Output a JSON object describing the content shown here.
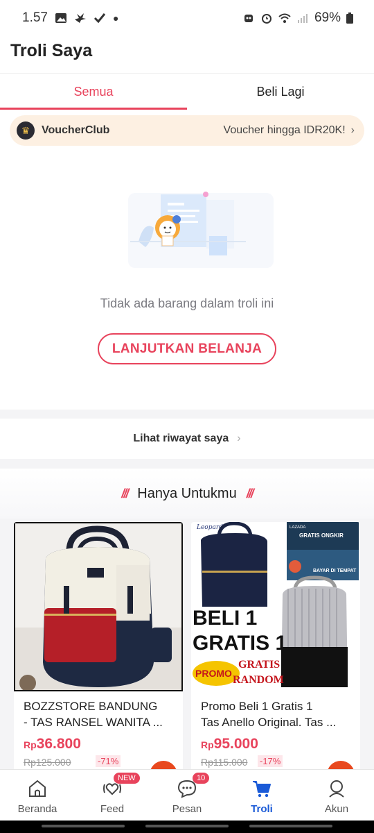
{
  "status_bar": {
    "time": "1.57",
    "battery": "69%"
  },
  "header": {
    "title": "Troli Saya"
  },
  "tabs": [
    {
      "label": "Semua",
      "active": true
    },
    {
      "label": "Beli Lagi",
      "active": false
    }
  ],
  "voucher": {
    "name": "VoucherClub",
    "promo": "Voucher hingga IDR20K!"
  },
  "empty_state": {
    "message": "Tidak ada barang dalam troli ini",
    "button_label": "LANJUTKAN BELANJA"
  },
  "history": {
    "label": "Lihat riwayat saya"
  },
  "for_you": {
    "title": "Hanya Untukmu"
  },
  "products": [
    {
      "name_line1": "BOZZSTORE BANDUNG",
      "name_line2": "- TAS RANSEL WANITA ...",
      "currency": "Rp",
      "price": "36.800",
      "original_price": "Rp125.000",
      "discount": "-71%"
    },
    {
      "name_line1": "Promo Beli 1 Gratis 1",
      "name_line2": "Tas Anello Original. Tas ...",
      "currency": "Rp",
      "price": "95.000",
      "original_price": "Rp115.000",
      "discount": "-17%",
      "image_text": {
        "brand": "Leopard",
        "lazada": "LAZADA",
        "gratis_ongkir": "GRATIS ONGKIR",
        "bayar": "BAYAR DI TEMPAT",
        "headline1": "BELI 1",
        "headline2": "GRATIS 1",
        "promo": "PROMO",
        "gratis_random1": "GRATIS",
        "gratis_random2": "RANDOM"
      }
    }
  ],
  "bottom_nav": [
    {
      "label": "Beranda",
      "icon": "home-icon"
    },
    {
      "label": "Feed",
      "icon": "feed-icon",
      "badge": "NEW"
    },
    {
      "label": "Pesan",
      "icon": "chat-icon",
      "badge": "10"
    },
    {
      "label": "Troli",
      "icon": "cart-icon",
      "active": true
    },
    {
      "label": "Akun",
      "icon": "account-icon"
    }
  ],
  "colors": {
    "accent": "#e8435c",
    "nav_active": "#1a5ad7",
    "voucher_bg": "#fdf0e2"
  }
}
